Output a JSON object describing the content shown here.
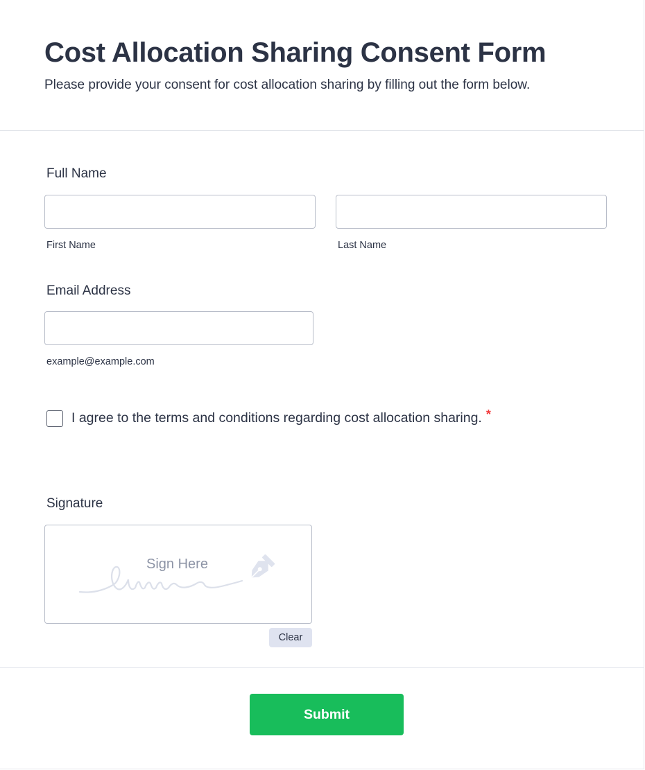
{
  "form": {
    "title": "Cost Allocation Sharing Consent Form",
    "subtitle": "Please provide your consent for cost allocation sharing by filling out the form below."
  },
  "full_name": {
    "label": "Full Name",
    "first_value": "",
    "first_sublabel": "First Name",
    "last_value": "",
    "last_sublabel": "Last Name"
  },
  "email": {
    "label": "Email Address",
    "value": "",
    "sublabel": "example@example.com"
  },
  "consent": {
    "checked": false,
    "label": "I agree to the terms and conditions regarding cost allocation sharing.",
    "required_mark": "*"
  },
  "signature": {
    "label": "Signature",
    "placeholder": "Sign Here",
    "clear_label": "Clear",
    "icon": "pen-nib-icon"
  },
  "submit": {
    "label": "Submit"
  },
  "colors": {
    "text": "#2c3345",
    "submit": "#18bd5b",
    "required": "#f23a3c",
    "clear_bg": "#dfe3f0",
    "input_border": "#b8bdc9"
  }
}
